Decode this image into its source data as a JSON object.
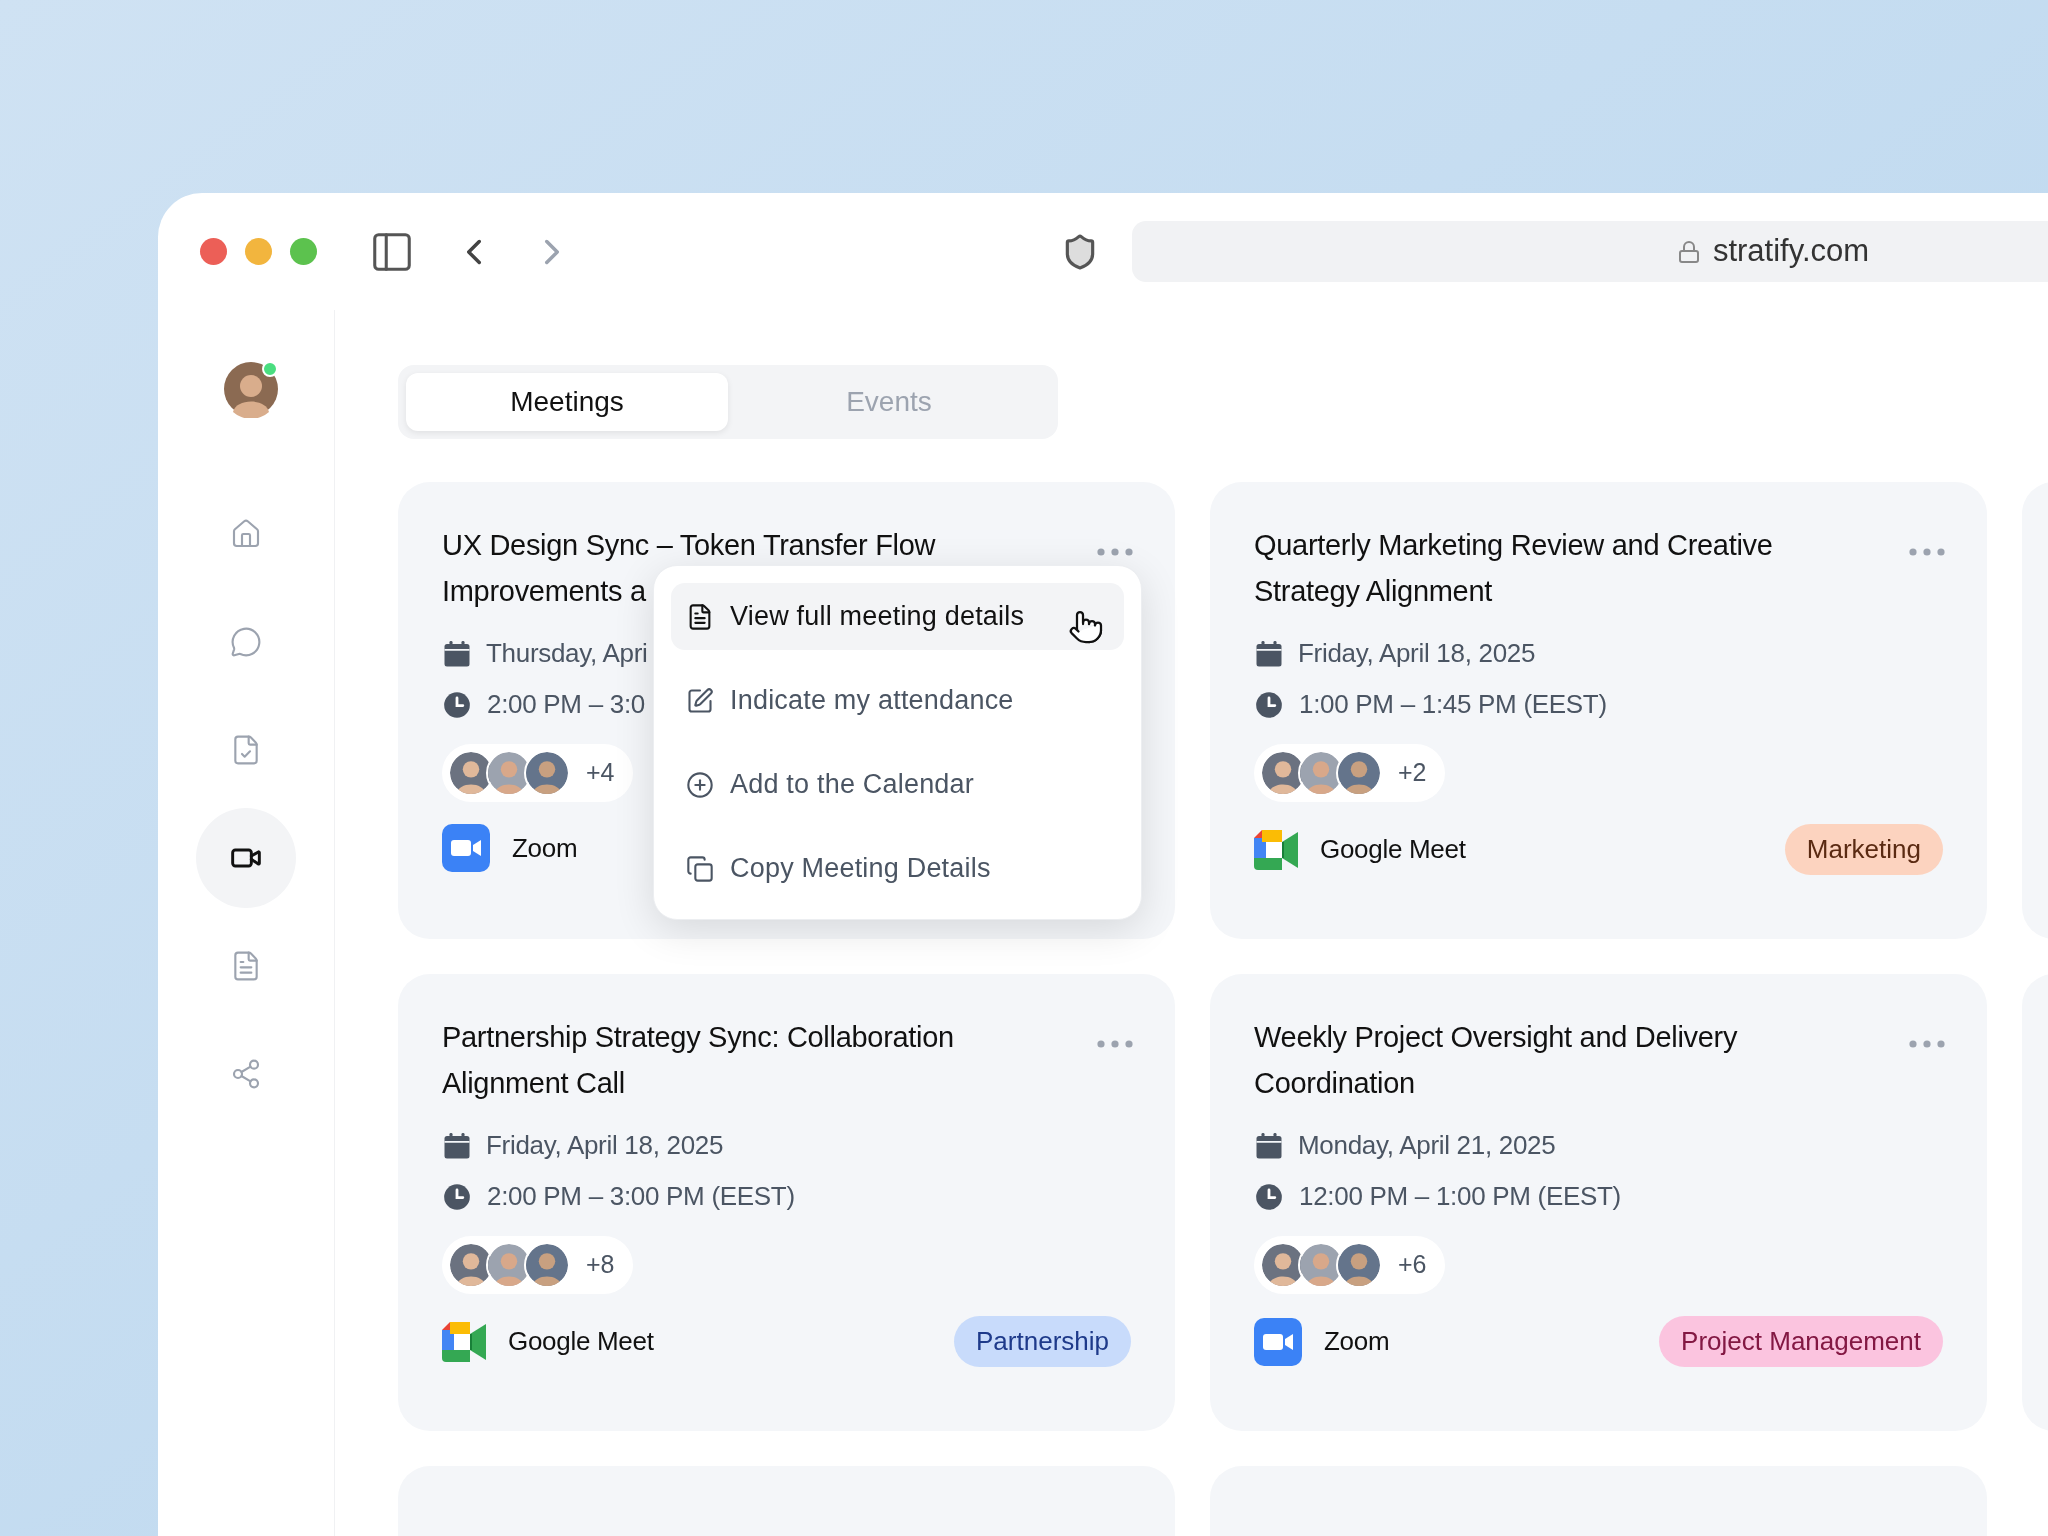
{
  "browser": {
    "url": "stratify.com"
  },
  "sidebar": {
    "items": [
      {
        "kind": "home",
        "selected": false
      },
      {
        "kind": "chat",
        "selected": false
      },
      {
        "kind": "tasks",
        "selected": false
      },
      {
        "kind": "video",
        "selected": true
      },
      {
        "kind": "document",
        "selected": false
      },
      {
        "kind": "share",
        "selected": false
      }
    ]
  },
  "tabs": [
    {
      "label": "Meetings",
      "selected": true
    },
    {
      "label": "Events",
      "selected": false
    }
  ],
  "meetings": [
    {
      "title": "UX Design Sync – Token Transfer Flow Improvements a",
      "date": "Thursday, Apri",
      "time": "2:00 PM – 3:0",
      "more": "+4",
      "platform": {
        "kind": "zoom",
        "name": "Zoom"
      },
      "menu": [
        {
          "kind": "details",
          "label": "View full meeting details",
          "selected": true
        },
        {
          "kind": "edit",
          "label": "Indicate my attendance",
          "selected": false
        },
        {
          "kind": "add",
          "label": "Add to the Calendar",
          "selected": false
        },
        {
          "kind": "copy",
          "label": "Copy Meeting Details",
          "selected": false
        }
      ]
    },
    {
      "title": "Quarterly Marketing Review and Creative Strategy Alignment",
      "date": "Friday, April 18, 2025",
      "time": "1:00 PM – 1:45 PM (EEST)",
      "more": "+2",
      "platform": {
        "kind": "meet",
        "name": "Google Meet"
      },
      "tag": {
        "label": "Marketing",
        "color": "#fcd3bf"
      }
    },
    {
      "title": "Partnership Strategy Sync: Collaboration Alignment Call",
      "date": "Friday, April 18, 2025",
      "time": "2:00 PM – 3:00 PM (EEST)",
      "more": "+8",
      "platform": {
        "kind": "meet",
        "name": "Google Meet"
      },
      "tag": {
        "label": "Partnership",
        "color": "#c8dbfb"
      }
    },
    {
      "title": "Weekly Project Oversight and Delivery Coordination",
      "date": "Monday, April 21, 2025",
      "time": "12:00 PM – 1:00 PM (EEST)",
      "more": "+6",
      "platform": {
        "kind": "zoom",
        "name": "Zoom"
      },
      "tag": {
        "label": "Project Management",
        "color": "#fbc4df"
      }
    }
  ]
}
